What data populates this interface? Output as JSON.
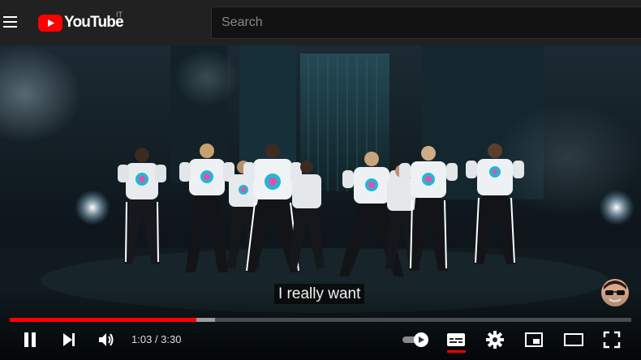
{
  "header": {
    "menu_icon": "hamburger-menu-icon",
    "logo_text": "YouTube",
    "region": "IT",
    "search_placeholder": "Search",
    "brand_color": "#ff0000"
  },
  "player": {
    "caption": "I really want",
    "current_time": "1:03",
    "separator": " / ",
    "duration": "3:30",
    "time_display": "1:03 / 3:30",
    "played_fraction": 0.3,
    "buffered_fraction": 0.33,
    "progress_color": "#ff0000",
    "controls": [
      {
        "name": "pause",
        "icon": "pause-icon"
      },
      {
        "name": "next",
        "icon": "next-icon"
      },
      {
        "name": "volume",
        "icon": "volume-icon"
      },
      {
        "name": "autoplay",
        "icon": "autoplay-toggle-icon"
      },
      {
        "name": "subtitles",
        "icon": "subtitles-icon"
      },
      {
        "name": "settings",
        "icon": "gear-icon"
      },
      {
        "name": "miniplayer",
        "icon": "miniplayer-icon"
      },
      {
        "name": "theater",
        "icon": "theater-mode-icon"
      },
      {
        "name": "fullscreen",
        "icon": "fullscreen-icon"
      }
    ]
  }
}
